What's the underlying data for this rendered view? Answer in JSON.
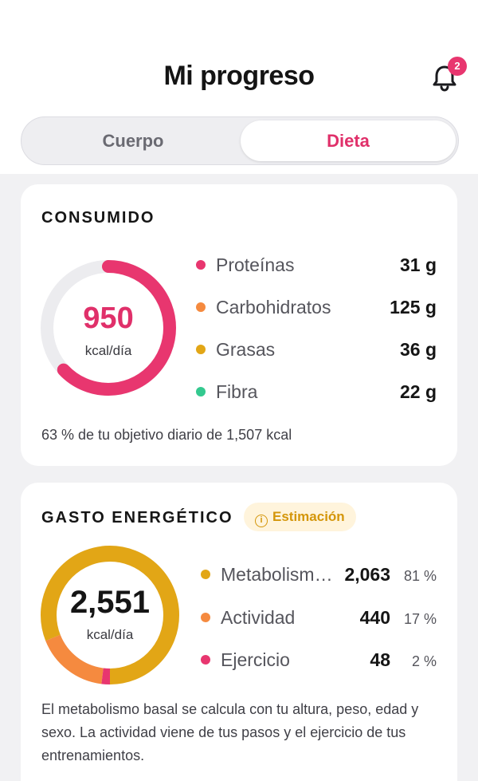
{
  "header": {
    "title": "Mi progreso",
    "notification_count": "2"
  },
  "tabs": [
    {
      "label": "Cuerpo",
      "selected": false
    },
    {
      "label": "Dieta",
      "selected": true
    }
  ],
  "colors": {
    "accent": "#e0306a",
    "protein": "#e8366f",
    "carbs": "#f58a3f",
    "fat": "#e2a616",
    "fiber": "#34c98f",
    "ring_track": "#ececef"
  },
  "consumed": {
    "title": "CONSUMIDO",
    "total_value": "950",
    "total_unit": "kcal/día",
    "progress_fraction": 0.63,
    "macros": [
      {
        "label": "Proteínas",
        "value": "31 g",
        "color": "#e8366f"
      },
      {
        "label": "Carbohidratos",
        "value": "125 g",
        "color": "#f58a3f"
      },
      {
        "label": "Grasas",
        "value": "36 g",
        "color": "#e2a616"
      },
      {
        "label": "Fibra",
        "value": "22 g",
        "color": "#34c98f"
      }
    ],
    "footnote": "63 % de tu objetivo diario de 1,507 kcal"
  },
  "expenditure": {
    "title": "GASTO ENERGÉTICO",
    "badge": "Estimación",
    "badge_icon": "info-icon",
    "total_value": "2,551",
    "total_unit": "kcal/día",
    "items": [
      {
        "label": "Metabolismo basal",
        "value": "2,063",
        "percent": "81 %",
        "fraction": 0.81,
        "color": "#e2a616"
      },
      {
        "label": "Actividad",
        "value": "440",
        "percent": "17 %",
        "fraction": 0.17,
        "color": "#f58a3f"
      },
      {
        "label": "Ejercicio",
        "value": "48",
        "percent": "2 %",
        "fraction": 0.02,
        "color": "#e8366f"
      }
    ],
    "footnote": "El metabolismo basal se calcula con tu altura, peso, edad y sexo. La actividad viene de tus pasos y el ejercicio de tus entrenamientos."
  }
}
